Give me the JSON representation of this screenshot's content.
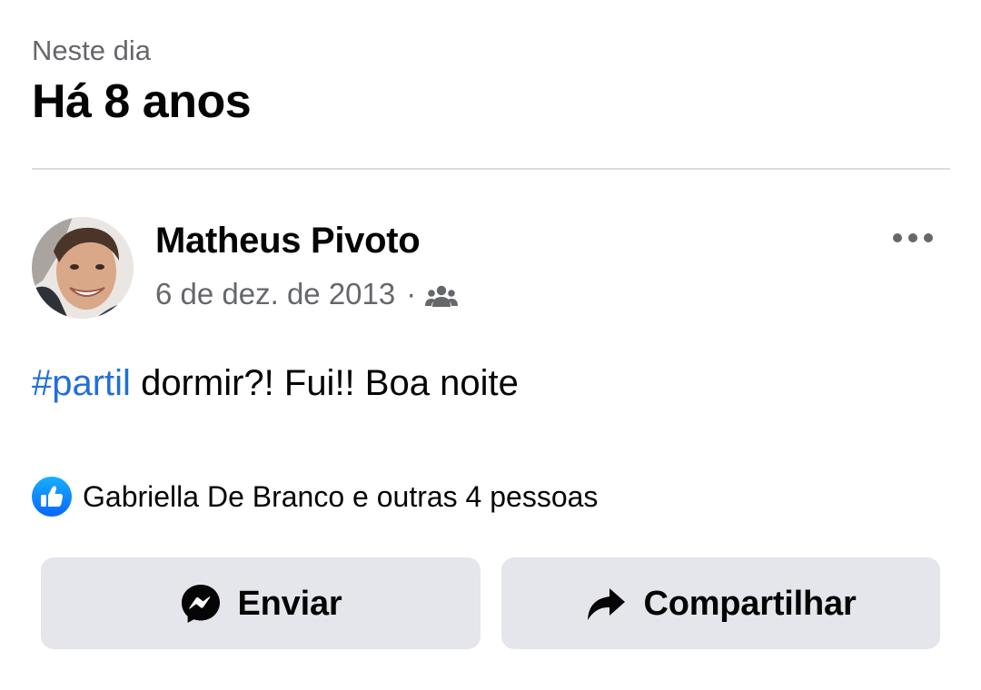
{
  "memory": {
    "label": "Neste dia",
    "title": "Há 8 anos"
  },
  "post": {
    "author": "Matheus Pivoto",
    "date": "6 de dez. de 2013",
    "meta_separator": "·",
    "audience_icon": "friends-icon",
    "more_icon": "more-options-icon",
    "hashtag": "#partil",
    "text": " dormir?! Fui!! Boa noite"
  },
  "reactions": {
    "icon": "like-icon",
    "summary": "Gabriella De Branco e outras 4 pessoas"
  },
  "actions": {
    "send_label": "Enviar",
    "send_icon": "messenger-icon",
    "share_label": "Compartilhar",
    "share_icon": "share-arrow-icon"
  },
  "colors": {
    "hashtag": "#216fdb",
    "like_badge": "#1877f2",
    "button_bg": "#e4e6eb",
    "secondary_text": "#65676b"
  }
}
